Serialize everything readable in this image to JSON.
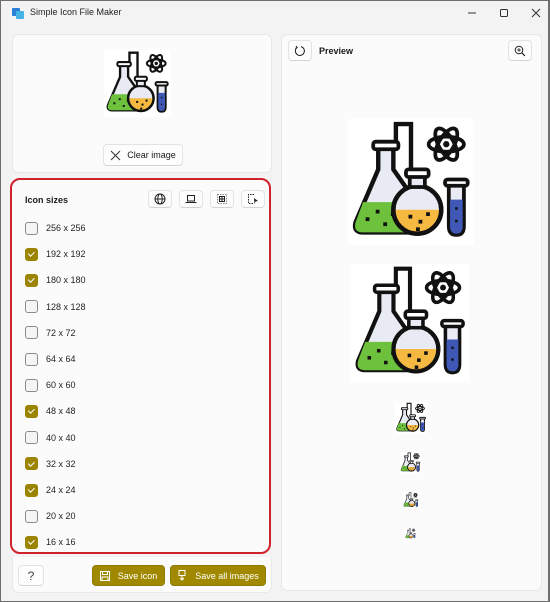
{
  "window": {
    "title": "Simple Icon File Maker",
    "controls": [
      "minimize",
      "maximize",
      "close"
    ]
  },
  "source": {
    "image_icon": "chemistry-flasks-icon",
    "clear_label": "Clear image"
  },
  "sizes": {
    "title": "Icon sizes",
    "toolbar": [
      {
        "name": "web-preset",
        "icon": "globe-icon"
      },
      {
        "name": "windows-preset",
        "icon": "laptop-icon"
      },
      {
        "name": "select-all",
        "icon": "grid-icon"
      },
      {
        "name": "custom-select",
        "icon": "select-cursor-icon"
      }
    ],
    "items": [
      {
        "label": "256 x 256",
        "checked": false
      },
      {
        "label": "192 x 192",
        "checked": true
      },
      {
        "label": "180 x 180",
        "checked": true
      },
      {
        "label": "128 x 128",
        "checked": false
      },
      {
        "label": "72 x 72",
        "checked": false
      },
      {
        "label": "64 x 64",
        "checked": false
      },
      {
        "label": "60 x 60",
        "checked": false
      },
      {
        "label": "48 x 48",
        "checked": true
      },
      {
        "label": "40 x 40",
        "checked": false
      },
      {
        "label": "32 x 32",
        "checked": true
      },
      {
        "label": "24 x 24",
        "checked": true
      },
      {
        "label": "20 x 20",
        "checked": false
      },
      {
        "label": "16 x 16",
        "checked": true
      }
    ]
  },
  "actions": {
    "help_label": "?",
    "save_icon_label": "Save icon",
    "save_all_label": "Save all images"
  },
  "preview": {
    "title": "Preview",
    "images": [
      "192 x 192",
      "180 x 180",
      "48 x 48",
      "32 x 32",
      "24 x 24",
      "16 x 16"
    ]
  },
  "colors": {
    "accent": "#a08900",
    "highlight_border": "#d0212c"
  }
}
